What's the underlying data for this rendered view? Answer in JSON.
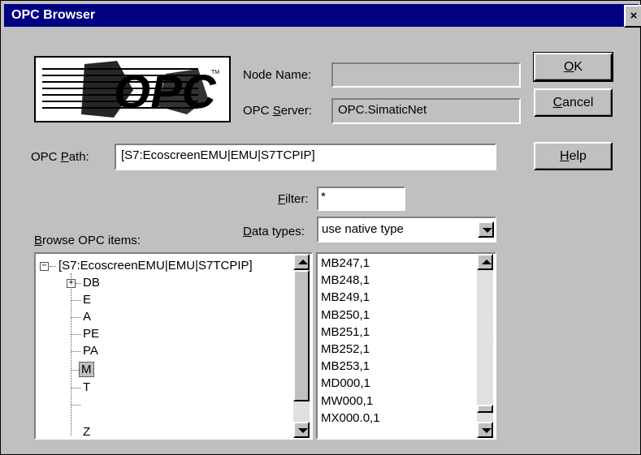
{
  "window": {
    "title": "OPC Browser",
    "close_glyph": "×"
  },
  "logo": {
    "text": "OPC",
    "tm": "TM"
  },
  "node_name": {
    "label": "Node Name:",
    "value": ""
  },
  "opc_server": {
    "label_pre": "OPC ",
    "label_ul": "S",
    "label_post": "erver:",
    "value": "OPC.SimaticNet"
  },
  "buttons": {
    "ok": {
      "ul": "O",
      "rest": "K"
    },
    "cancel": {
      "ul": "C",
      "rest": "ancel"
    },
    "help": {
      "ul": "H",
      "rest": "elp"
    }
  },
  "opc_path": {
    "label_pre": "OPC ",
    "label_ul": "P",
    "label_post": "ath:",
    "value": "[S7:EcoscreenEMU|EMU|S7TCPIP]"
  },
  "filter": {
    "label_ul": "F",
    "label_post": "ilter:",
    "value": "*"
  },
  "data_types": {
    "label_ul": "D",
    "label_post": "ata types:",
    "value": "use native type"
  },
  "browse": {
    "label_ul": "B",
    "label_post": "rowse OPC items:"
  },
  "tree": {
    "root": {
      "expander": "−",
      "label": "[S7:EcoscreenEMU|EMU|S7TCPIP]"
    },
    "children": [
      {
        "expander": "+",
        "label": "DB"
      },
      {
        "label": "E"
      },
      {
        "label": "A"
      },
      {
        "label": "PE"
      },
      {
        "label": "PA"
      },
      {
        "label": "M",
        "selected": true
      },
      {
        "label": "T"
      },
      {
        "label": "Z"
      }
    ]
  },
  "items": [
    "MB247,1",
    "MB248,1",
    "MB249,1",
    "MB250,1",
    "MB251,1",
    "MB252,1",
    "MB253,1",
    "MD000,1",
    "MW000,1",
    "MX000.0,1"
  ],
  "icons": {
    "up": "scroll-up-arrow",
    "down": "scroll-down-arrow",
    "dropdown": "dropdown-arrow"
  },
  "colors": {
    "titlebar": "#000080",
    "face": "#c0c0c0"
  }
}
